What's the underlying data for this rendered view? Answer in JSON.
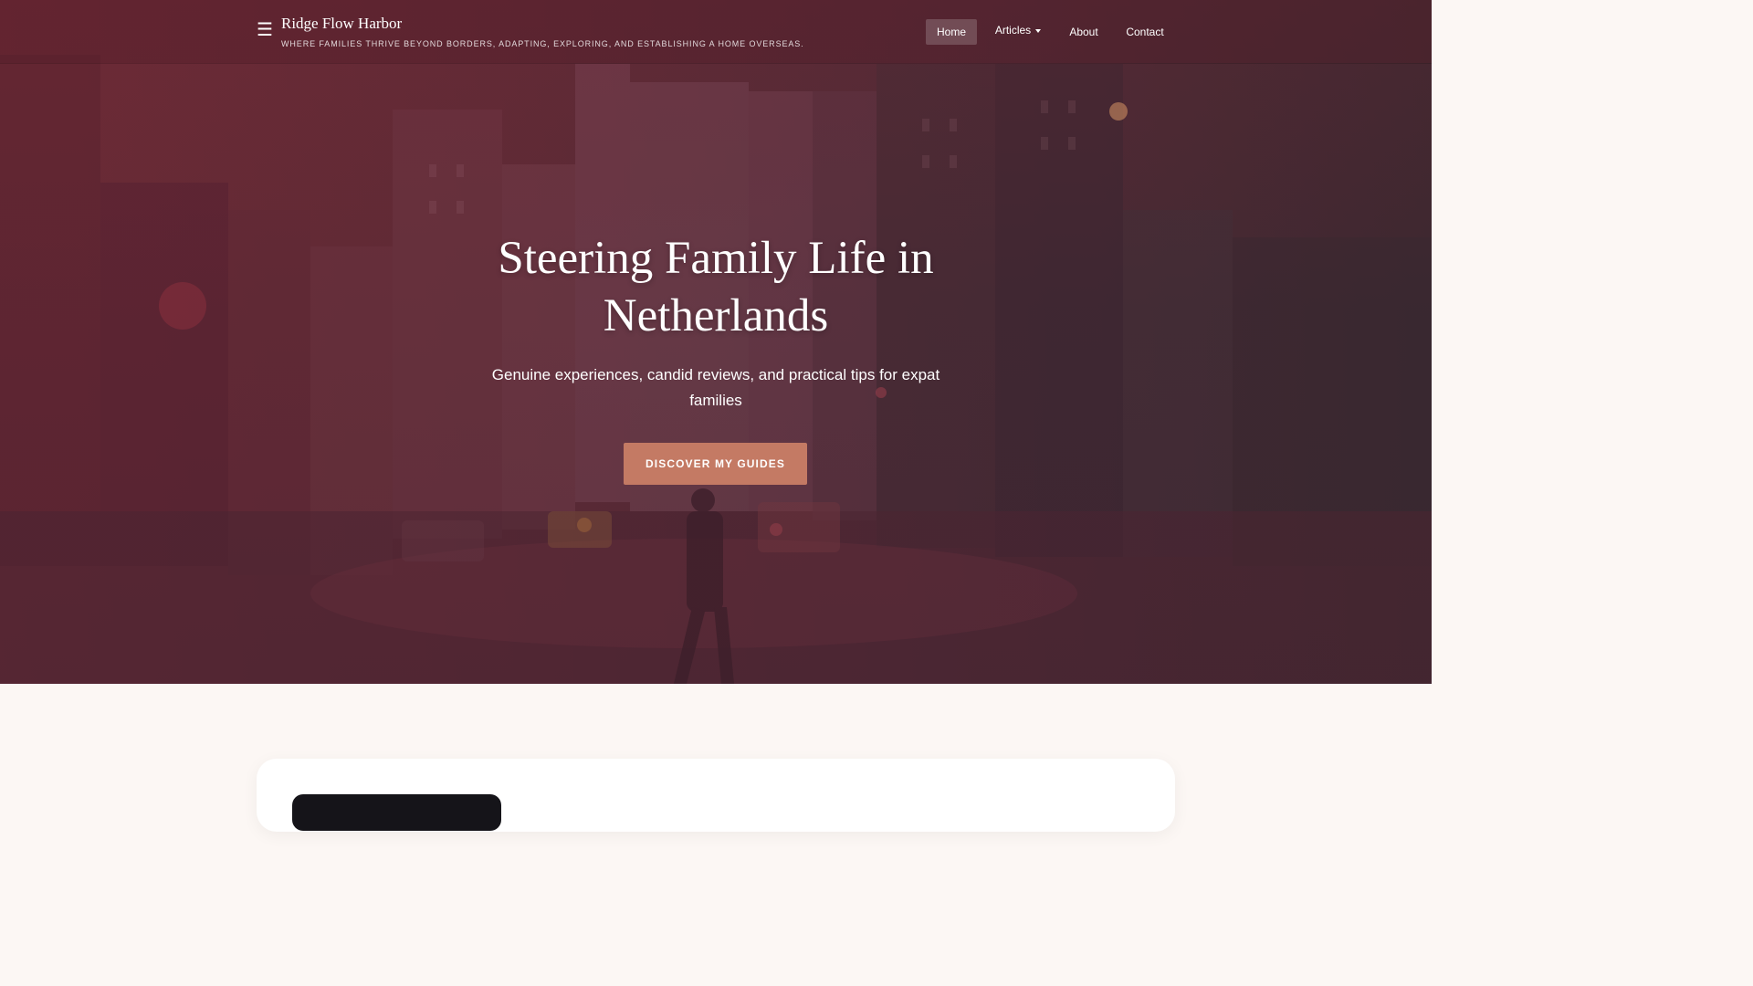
{
  "header": {
    "brand_title": "Ridge Flow Harbor",
    "brand_tagline": "WHERE FAMILIES THRIVE BEYOND BORDERS, ADAPTING, EXPLORING, AND ESTABLISHING A HOME OVERSEAS.",
    "menu_icon": "hamburger-menu-icon",
    "nav": {
      "home": "Home",
      "articles": "Articles",
      "about": "About",
      "contact": "Contact"
    }
  },
  "hero": {
    "title": "Steering Family Life in Netherlands",
    "subtitle": "Genuine experiences, candid reviews, and practical tips for expat families",
    "cta_label": "DISCOVER MY GUIDES"
  },
  "colors": {
    "accent": "#c47a64",
    "hero_tint": "#6a2a35",
    "page_background": "#fcf7f4",
    "card_media": "#151419"
  }
}
